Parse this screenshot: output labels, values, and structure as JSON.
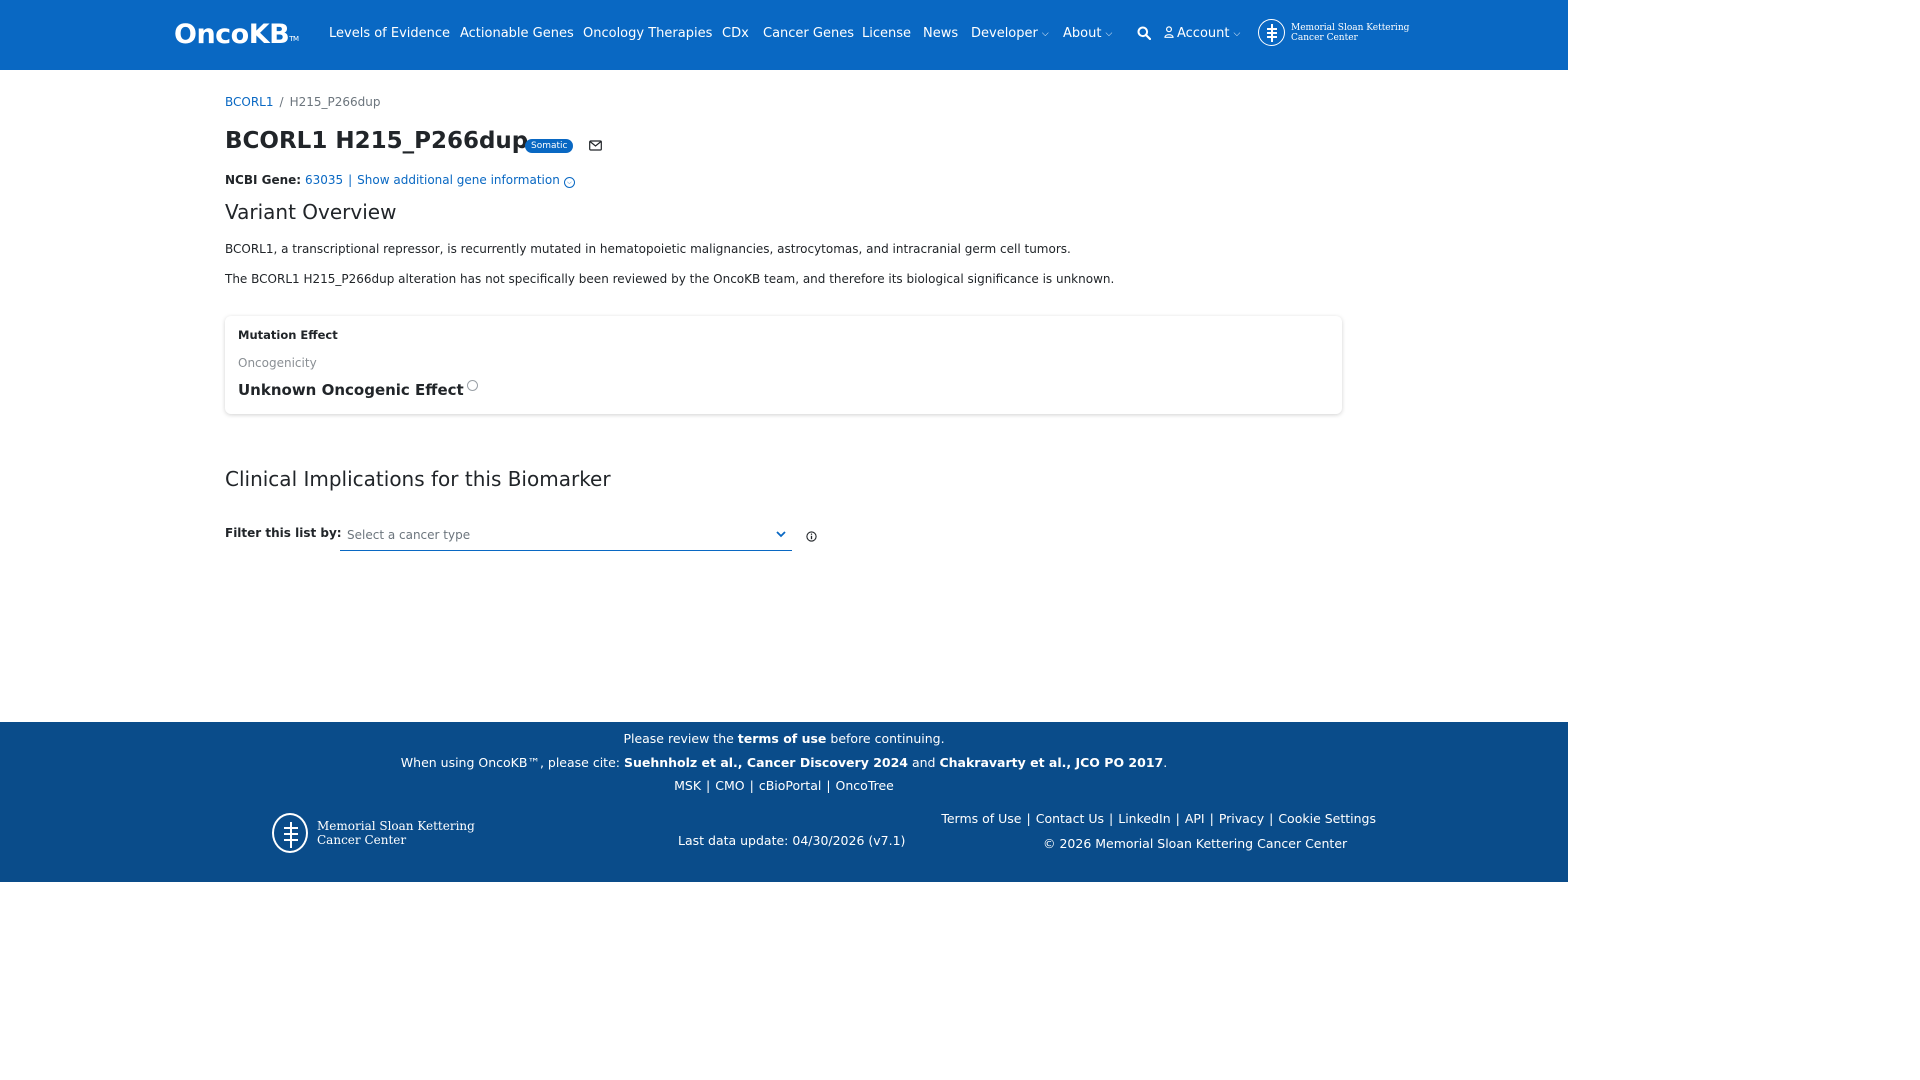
{
  "header": {
    "logo_text": "OncoKB",
    "logo_tm": "TM",
    "nav": [
      {
        "label": "Levels of Evidence"
      },
      {
        "label": "Actionable Genes"
      },
      {
        "label": "Oncology Therapies"
      },
      {
        "label": "CDx"
      },
      {
        "label": "Cancer Genes"
      },
      {
        "label": "License"
      },
      {
        "label": "News"
      },
      {
        "label": "Developer"
      },
      {
        "label": "About"
      }
    ],
    "account_label": "Account",
    "msk_logo": {
      "line1": "Memorial Sloan Kettering",
      "line2": "Cancer Center"
    }
  },
  "breadcrumb": {
    "gene": "BCORL1",
    "separator": "/",
    "current": "H215_P266dup"
  },
  "title": {
    "text": "BCORL1 H215_P266dup",
    "badge": "Somatic"
  },
  "ncbi": {
    "label": "NCBI Gene:",
    "gene_id": "63035",
    "separator": "|",
    "more_link": "Show additional gene information"
  },
  "overview": {
    "title": "Variant Overview",
    "para1": "BCORL1, a transcriptional repressor, is recurrently mutated in hematopoietic malignancies, astrocytomas, and intracranial germ cell tumors.",
    "para2": "The BCORL1 H215_P266dup alteration has not specifically been reviewed by the OncoKB team, and therefore its biological significance is unknown."
  },
  "mutation_card": {
    "title": "Mutation Effect",
    "subtitle": "Oncogenicity",
    "value": "Unknown Oncogenic Effect"
  },
  "clinical": {
    "title": "Clinical Implications for this Biomarker",
    "filter_label": "Filter this list by:",
    "select_placeholder": "Select a cancer type"
  },
  "footer": {
    "terms_pre": "Please review the ",
    "terms_link": "terms of use",
    "terms_post": " before continuing.",
    "cite_pre": "When using OncoKB™, please cite: ",
    "cite1": "Suehnholz et al., Cancer Discovery 2024",
    "cite_mid": " and ",
    "cite2": "Chakravarty et al., JCO PO 2017",
    "cite_end": ".",
    "resources": [
      "MSK",
      "CMO",
      "cBioPortal",
      "OncoTree"
    ],
    "msk_logo": {
      "line1": "Memorial Sloan Kettering",
      "line2": "Cancer Center"
    },
    "last_update": "Last data update: 04/30/2026 (v7.1)",
    "links": [
      "Terms of Use",
      "Contact Us",
      "LinkedIn",
      "API",
      "Privacy",
      "Cookie Settings"
    ],
    "copyright": "© 2026 Memorial Sloan Kettering Cancer Center"
  },
  "colors": {
    "brand": "#0968c3",
    "footer": "#0a4c8a"
  }
}
